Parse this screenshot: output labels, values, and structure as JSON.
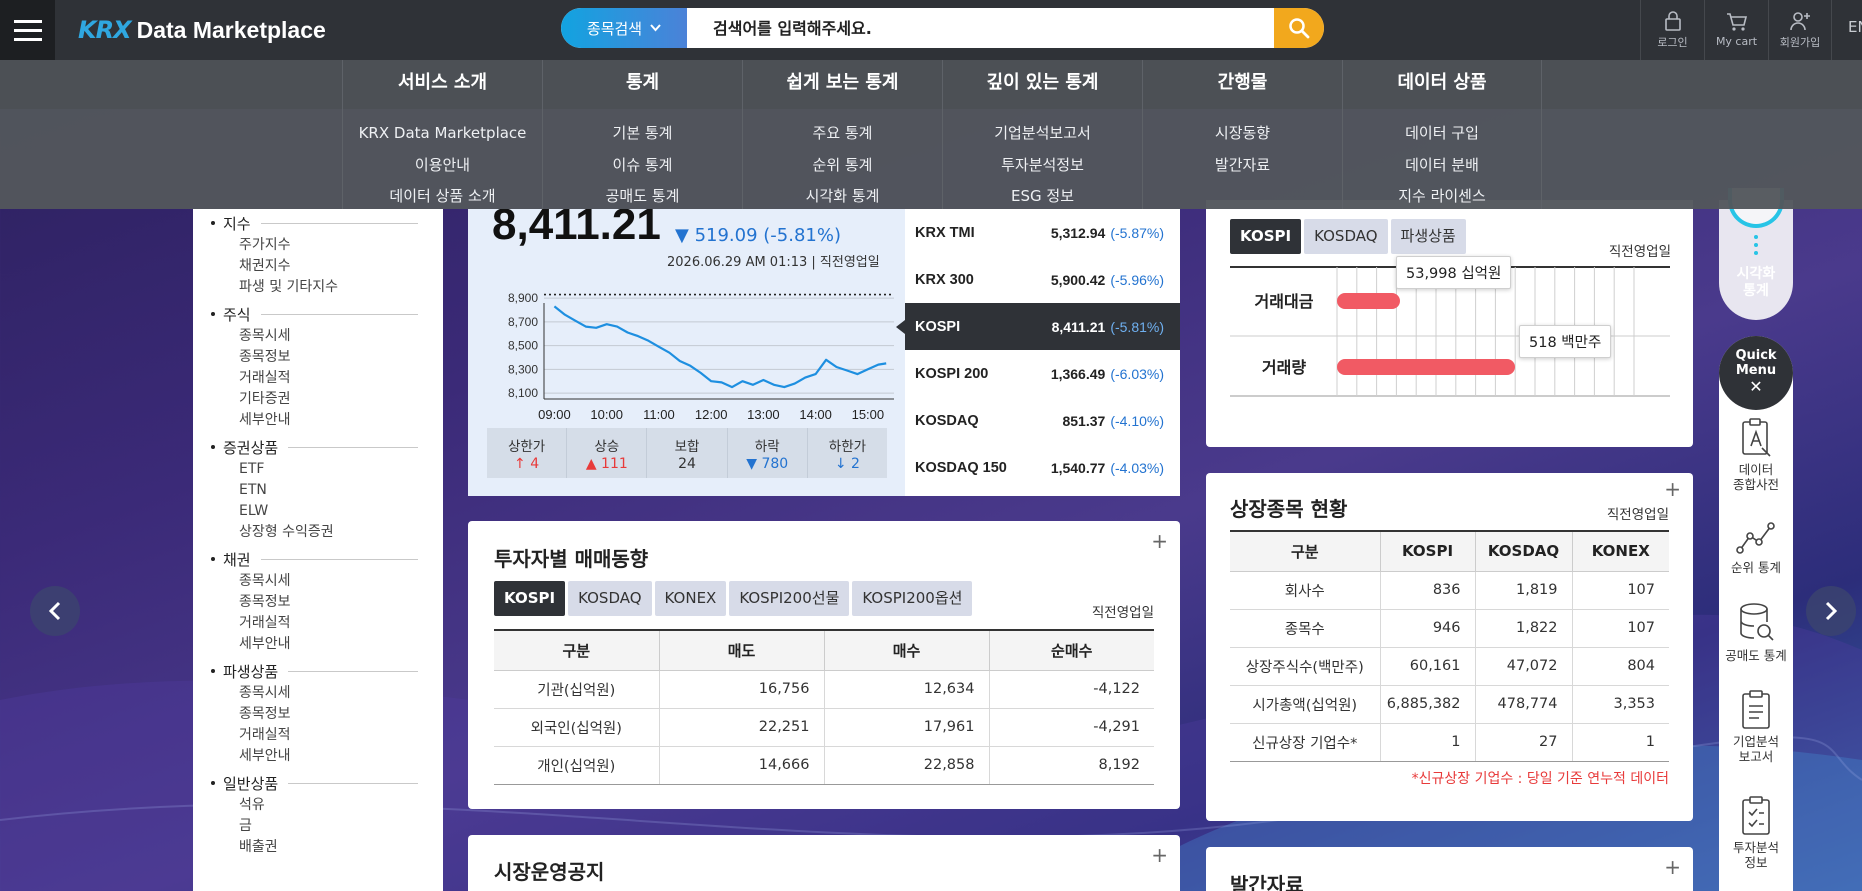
{
  "header": {
    "logo_mark": "KRX",
    "logo_text": "Data Marketplace",
    "search": {
      "category_label": "종목검색",
      "placeholder": "검색어를 입력해주세요."
    },
    "actions": [
      {
        "icon": "lock-icon",
        "label": "로그인"
      },
      {
        "icon": "cart-icon",
        "label": "My cart"
      },
      {
        "icon": "user-plus-icon",
        "label": "회원가입"
      }
    ],
    "lang": "EN"
  },
  "nav": [
    {
      "label": "서비스 소개",
      "items": [
        "KRX Data Marketplace",
        "이용안내",
        "데이터 상품 소개"
      ]
    },
    {
      "label": "통계",
      "items": [
        "기본 통계",
        "이슈 통계",
        "공매도 통계"
      ]
    },
    {
      "label": "쉽게 보는 통계",
      "items": [
        "주요 통계",
        "순위 통계",
        "시각화 통계"
      ]
    },
    {
      "label": "깊이 있는 통계",
      "items": [
        "기업분석보고서",
        "투자분석정보",
        "ESG 정보"
      ]
    },
    {
      "label": "간행물",
      "items": [
        "시장동향",
        "발간자료"
      ]
    },
    {
      "label": "데이터 상품",
      "items": [
        "데이터 구입",
        "데이터 분배",
        "지수 라이센스"
      ]
    }
  ],
  "sidebar": [
    {
      "head": "지수",
      "items": [
        "주가지수",
        "채권지수",
        "파생 및 기타지수"
      ]
    },
    {
      "head": "주식",
      "items": [
        "종목시세",
        "종목정보",
        "거래실적",
        "기타증권",
        "세부안내"
      ]
    },
    {
      "head": "증권상품",
      "items": [
        "ETF",
        "ETN",
        "ELW",
        "상장형 수익증권"
      ]
    },
    {
      "head": "채권",
      "items": [
        "종목시세",
        "종목정보",
        "거래실적",
        "세부안내"
      ]
    },
    {
      "head": "파생상품",
      "items": [
        "종목시세",
        "종목정보",
        "거래실적",
        "세부안내"
      ]
    },
    {
      "head": "일반상품",
      "items": [
        "석유",
        "금",
        "배출권"
      ]
    }
  ],
  "index_panel": {
    "value": "8,411.21",
    "change": "▼ 519.09 (-5.81%)",
    "time": "2026.06.29 AM 01:13 | 직전영업일",
    "breadth": [
      {
        "label": "상한가",
        "value": "↑ 4",
        "color": "#e83a3a"
      },
      {
        "label": "상승",
        "value": "▲ 111",
        "color": "#e83a3a"
      },
      {
        "label": "보합",
        "value": "24",
        "color": "#333333"
      },
      {
        "label": "하락",
        "value": "▼ 780",
        "color": "#2373d0"
      },
      {
        "label": "하한가",
        "value": "↓ 2",
        "color": "#2373d0"
      }
    ],
    "list": [
      {
        "name": "KRX TMI",
        "value": "5,312.94",
        "change": "(-5.87%)"
      },
      {
        "name": "KRX 300",
        "value": "5,900.42",
        "change": "(-5.96%)"
      },
      {
        "name": "KOSPI",
        "value": "8,411.21",
        "change": "(-5.81%)",
        "active": true
      },
      {
        "name": "KOSPI 200",
        "value": "1,366.49",
        "change": "(-6.03%)"
      },
      {
        "name": "KOSDAQ",
        "value": "851.37",
        "change": "(-4.10%)"
      },
      {
        "name": "KOSDAQ 150",
        "value": "1,540.77",
        "change": "(-4.03%)"
      }
    ]
  },
  "chart_data": {
    "type": "line",
    "title": "",
    "xlabel": "",
    "ylabel": "",
    "x_ticks": [
      "09:00",
      "10:00",
      "11:00",
      "12:00",
      "13:00",
      "14:00",
      "15:00"
    ],
    "y_ticks": [
      8100,
      8300,
      8500,
      8700,
      8900
    ],
    "ylim": [
      8050,
      8960
    ],
    "xlim": [
      8.8,
      15.5
    ],
    "reference_line": 8930,
    "grid": true,
    "x": [
      9.0,
      9.2,
      9.4,
      9.6,
      9.8,
      10.0,
      10.2,
      10.4,
      10.6,
      10.8,
      11.0,
      11.2,
      11.4,
      11.6,
      11.8,
      12.0,
      12.2,
      12.4,
      12.6,
      12.8,
      13.0,
      13.2,
      13.4,
      13.6,
      13.8,
      14.0,
      14.2,
      14.4,
      14.6,
      14.8,
      15.0,
      15.2,
      15.35
    ],
    "y": [
      8830,
      8760,
      8710,
      8660,
      8650,
      8680,
      8660,
      8610,
      8580,
      8540,
      8490,
      8440,
      8370,
      8330,
      8270,
      8200,
      8190,
      8150,
      8200,
      8170,
      8210,
      8170,
      8150,
      8180,
      8230,
      8260,
      8380,
      8320,
      8290,
      8260,
      8300,
      8340,
      8350
    ]
  },
  "investor_card": {
    "title": "투자자별 매매동향",
    "tabs": [
      "KOSPI",
      "KOSDAQ",
      "KONEX",
      "KOSPI200선물",
      "KOSPI200옵션"
    ],
    "tag": "직전영업일",
    "headers": [
      "구분",
      "매도",
      "매수",
      "순매수"
    ],
    "rows": [
      [
        "기관(십억원)",
        "16,756",
        "12,634",
        "-4,122"
      ],
      [
        "외국인(십억원)",
        "22,251",
        "17,961",
        "-4,291"
      ],
      [
        "개인(십억원)",
        "14,666",
        "22,858",
        "8,192"
      ]
    ]
  },
  "notice_card": {
    "title": "시장운영공지"
  },
  "volume_card": {
    "tabs": [
      "KOSPI",
      "KOSDAQ",
      "파생상품"
    ],
    "tag": "직전영업일",
    "rows": [
      {
        "label": "거래대금",
        "value": 53998,
        "text": "53,998 십억원"
      },
      {
        "label": "거래량",
        "value": 518,
        "text": "518 백만주"
      }
    ],
    "bar_color": "#f15a64"
  },
  "listing_card": {
    "title": "상장종목 현황",
    "tag": "직전영업일",
    "headers": [
      "구분",
      "KOSPI",
      "KOSDAQ",
      "KONEX"
    ],
    "rows": [
      [
        "회사수",
        "836",
        "1,819",
        "107"
      ],
      [
        "종목수",
        "946",
        "1,822",
        "107"
      ],
      [
        "상장주식수(백만주)",
        "60,161",
        "47,072",
        "804"
      ],
      [
        "시가총액(십억원)",
        "6,885,382",
        "478,774",
        "3,353"
      ],
      [
        "신규상장 기업수*",
        "1",
        "27",
        "1"
      ]
    ],
    "footnote": "*신규상장 기업수 : 당일 기준 연누적 데이터"
  },
  "publication_card": {
    "title": "발간자료"
  },
  "quick_menu": {
    "top_label": "시각화\n통계",
    "button_label": "Quick\nMenu",
    "items": [
      {
        "icon": "dictionary-icon",
        "label": "데이터\n종합사전"
      },
      {
        "icon": "rank-chart-icon",
        "label": "순위 통계"
      },
      {
        "icon": "database-search-icon",
        "label": "공매도 통계"
      },
      {
        "icon": "report-icon",
        "label": "기업분석\n보고서"
      },
      {
        "icon": "document-icon",
        "label": "투자분석\n정보"
      }
    ]
  }
}
